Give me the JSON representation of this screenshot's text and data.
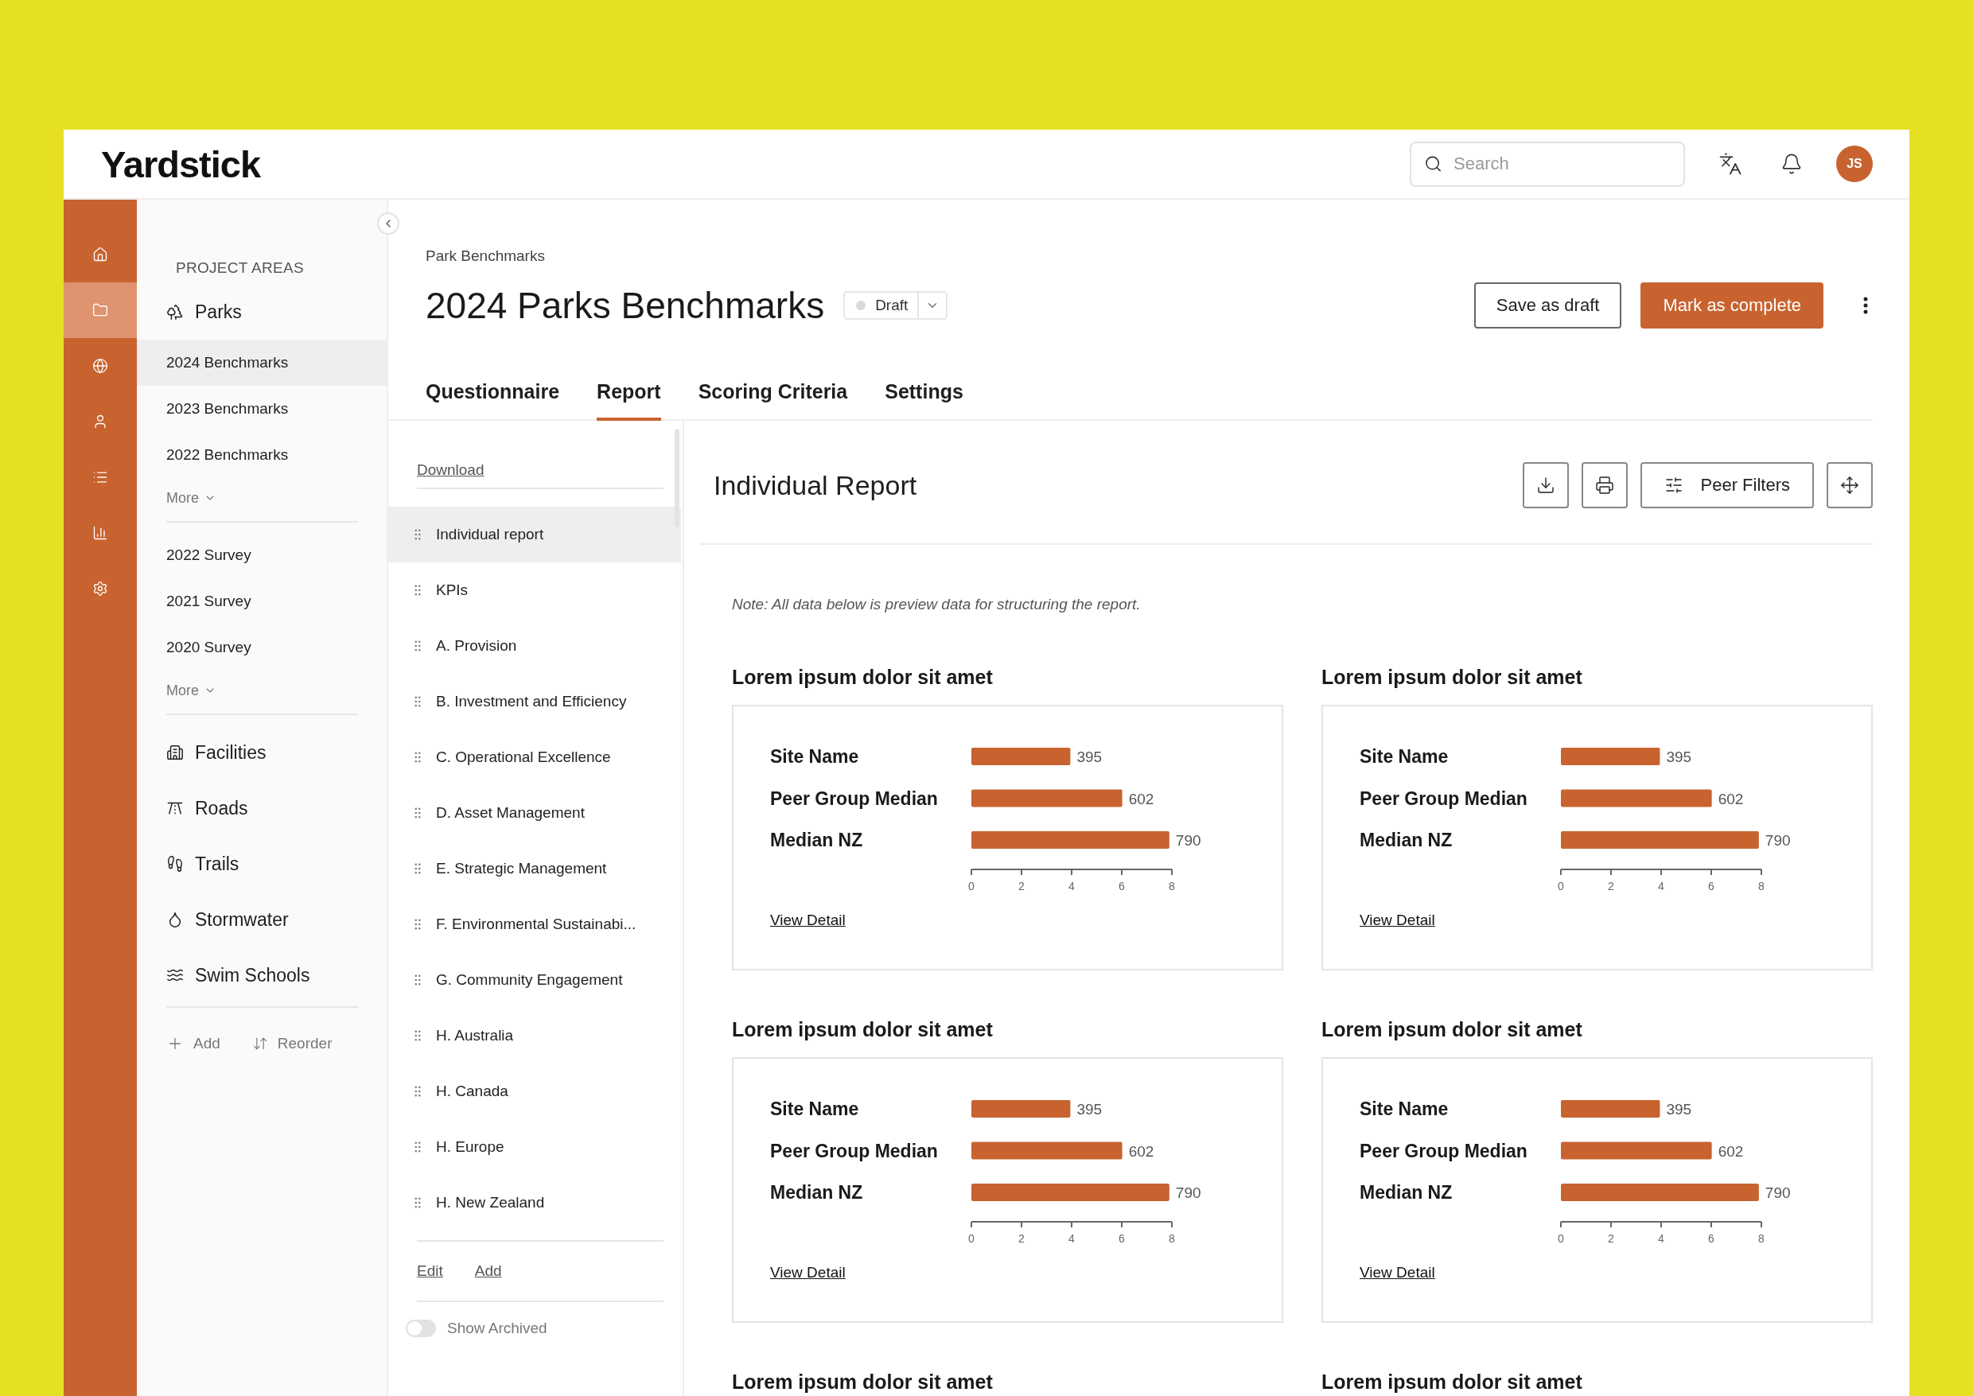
{
  "header": {
    "logo": "Yardstick",
    "search": {
      "placeholder": "Search"
    },
    "avatar": "JS"
  },
  "rail": [
    {
      "kind": "home",
      "selected": false
    },
    {
      "kind": "folder",
      "selected": true
    },
    {
      "kind": "globe",
      "selected": false
    },
    {
      "kind": "user",
      "selected": false
    },
    {
      "kind": "list",
      "selected": false
    },
    {
      "kind": "chart",
      "selected": false
    },
    {
      "kind": "settings",
      "selected": false
    }
  ],
  "sidebar": {
    "heading": "PROJECT AREAS",
    "areas": [
      {
        "label": "Parks",
        "kind": "parks",
        "sections": [
          {
            "items": [
              {
                "label": "2024 Benchmarks",
                "selected": true
              },
              {
                "label": "2023 Benchmarks",
                "selected": false
              },
              {
                "label": "2022 Benchmarks",
                "selected": false
              }
            ],
            "more": "More"
          },
          {
            "items": [
              {
                "label": "2022 Survey",
                "selected": false
              },
              {
                "label": "2021 Survey",
                "selected": false
              },
              {
                "label": "2020 Survey",
                "selected": false
              }
            ],
            "more": "More"
          }
        ]
      },
      {
        "label": "Facilities",
        "kind": "facilities"
      },
      {
        "label": "Roads",
        "kind": "roads"
      },
      {
        "label": "Trails",
        "kind": "trails"
      },
      {
        "label": "Stormwater",
        "kind": "stormwater"
      },
      {
        "label": "Swim Schools",
        "kind": "swim"
      }
    ],
    "actions": [
      {
        "label": "Add",
        "kind": "add"
      },
      {
        "label": "Reorder",
        "kind": "reorder"
      }
    ]
  },
  "page": {
    "breadcrumb": "Park Benchmarks",
    "title": "2024 Parks Benchmarks",
    "status": "Draft",
    "buttons": [
      {
        "label": "Save as draft",
        "kind": "secondary"
      },
      {
        "label": "Mark as complete",
        "kind": "primary"
      }
    ]
  },
  "tabs": [
    {
      "label": "Questionnaire",
      "selected": false
    },
    {
      "label": "Report",
      "selected": true
    },
    {
      "label": "Scoring Criteria",
      "selected": false
    },
    {
      "label": "Settings",
      "selected": false
    }
  ],
  "report_nav": {
    "download": "Download",
    "items": [
      {
        "label": "Individual report",
        "selected": true
      },
      {
        "label": "KPIs",
        "selected": false
      },
      {
        "label": "A. Provision",
        "selected": false
      },
      {
        "label": "B. Investment and Efficiency",
        "selected": false
      },
      {
        "label": "C. Operational Excellence",
        "selected": false
      },
      {
        "label": "D. Asset Management",
        "selected": false
      },
      {
        "label": "E. Strategic Management",
        "selected": false
      },
      {
        "label": "F. Environmental Sustainabi...",
        "selected": false
      },
      {
        "label": "G. Community Engagement",
        "selected": false
      },
      {
        "label": "H. Australia",
        "selected": false
      },
      {
        "label": "H. Canada",
        "selected": false
      },
      {
        "label": "H. Europe",
        "selected": false
      },
      {
        "label": "H. New Zealand",
        "selected": false
      }
    ],
    "links": [
      "Edit",
      "Add"
    ],
    "toggle": {
      "label": "Show Archived",
      "on": false
    }
  },
  "report": {
    "title": "Individual Report",
    "tools": [
      {
        "kind": "download"
      },
      {
        "kind": "print"
      },
      {
        "kind": "filter",
        "label": "Peer Filters"
      },
      {
        "kind": "expand"
      }
    ],
    "note": "Note: All data below is preview data for structuring the report.",
    "cards": [
      {
        "title": "Lorem ipsum dolor sit amet",
        "link": "View Detail",
        "axis_labels": [
          "0",
          "2",
          "4",
          "6",
          "8"
        ],
        "chart_data": {
          "type": "bar",
          "orientation": "horizontal",
          "categories": [
            "Site Name",
            "Peer Group Median",
            "Median NZ"
          ],
          "values": [
            395,
            602,
            790
          ],
          "value_labels": [
            "395",
            "602",
            "790"
          ],
          "xlim": [
            0,
            800
          ]
        }
      },
      {
        "title": "Lorem ipsum dolor sit amet",
        "link": "View Detail",
        "axis_labels": [
          "0",
          "2",
          "4",
          "6",
          "8"
        ],
        "chart_data": {
          "type": "bar",
          "orientation": "horizontal",
          "categories": [
            "Site Name",
            "Peer Group Median",
            "Median NZ"
          ],
          "values": [
            395,
            602,
            790
          ],
          "value_labels": [
            "395",
            "602",
            "790"
          ],
          "xlim": [
            0,
            800
          ]
        }
      },
      {
        "title": "Lorem ipsum dolor sit amet",
        "link": "View Detail",
        "axis_labels": [
          "0",
          "2",
          "4",
          "6",
          "8"
        ],
        "chart_data": {
          "type": "bar",
          "orientation": "horizontal",
          "categories": [
            "Site Name",
            "Peer Group Median",
            "Median NZ"
          ],
          "values": [
            395,
            602,
            790
          ],
          "value_labels": [
            "395",
            "602",
            "790"
          ],
          "xlim": [
            0,
            800
          ]
        }
      },
      {
        "title": "Lorem ipsum dolor sit amet",
        "link": "View Detail",
        "axis_labels": [
          "0",
          "2",
          "4",
          "6",
          "8"
        ],
        "chart_data": {
          "type": "bar",
          "orientation": "horizontal",
          "categories": [
            "Site Name",
            "Peer Group Median",
            "Median NZ"
          ],
          "values": [
            395,
            602,
            790
          ],
          "value_labels": [
            "395",
            "602",
            "790"
          ],
          "xlim": [
            0,
            800
          ]
        }
      },
      {
        "title": "Lorem ipsum dolor sit amet"
      },
      {
        "title": "Lorem ipsum dolor sit amet"
      }
    ]
  }
}
